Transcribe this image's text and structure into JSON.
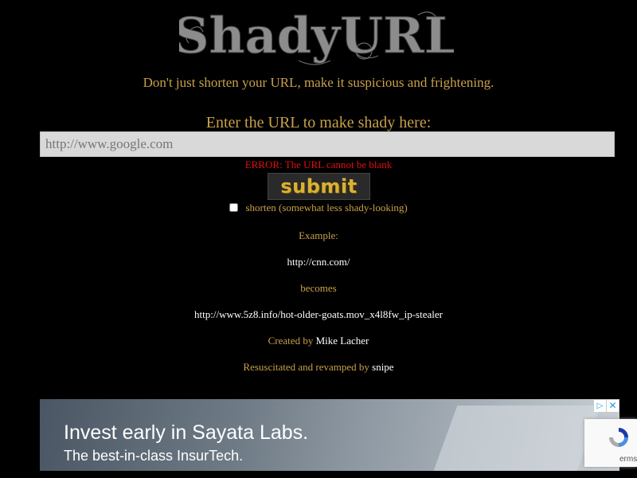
{
  "header": {
    "logo_text": "ShadyURL",
    "tagline": "Don't just shorten your URL, make it suspicious and frightening."
  },
  "form": {
    "prompt": "Enter the URL to make shady here:",
    "url_placeholder": "http://www.google.com",
    "url_value": "",
    "error": "ERROR: The URL cannot be blank",
    "submit_label": "submit",
    "shorten_label": "shorten (somewhat less shady-looking)",
    "shorten_checked": false
  },
  "example": {
    "label": "Example:",
    "input_url": "http://cnn.com/",
    "becomes_label": "becomes",
    "output_url": "http://www.5z8.info/hot-older-goats.mov_x4l8fw_ip-stealer"
  },
  "credits": {
    "created_by_label": "Created by",
    "creator": "Mike Lacher",
    "resuscitated_label": "Resuscitated and revamped by",
    "reviver": "snipe"
  },
  "ad": {
    "headline": "Invest early in Sayata Labs.",
    "subline": "The best-in-class InsurTech.",
    "choices_icon": "adchoices-icon",
    "close_icon": "close-icon"
  },
  "recaptcha": {
    "icon": "recaptcha-icon",
    "text_fragment": "erms"
  },
  "colors": {
    "background": "#000000",
    "accent_gold": "#c8a04a",
    "error_red": "#e01010",
    "link_white": "#ffffff"
  }
}
